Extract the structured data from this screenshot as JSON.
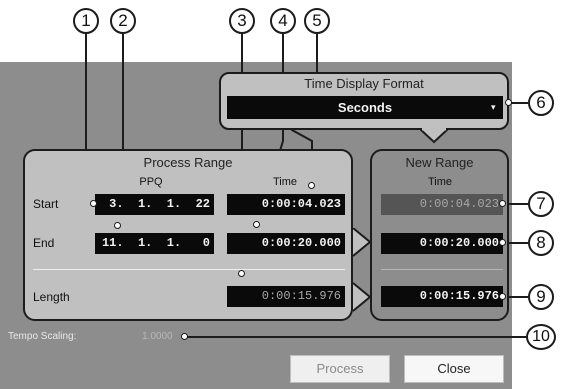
{
  "callouts": [
    "1",
    "2",
    "3",
    "4",
    "5",
    "6",
    "7",
    "8",
    "9",
    "10"
  ],
  "time_display_format": {
    "title": "Time Display Format",
    "selected": "Seconds"
  },
  "process_range": {
    "title": "Process Range",
    "col_ppq": "PPQ",
    "col_time": "Time",
    "rows": {
      "start_label": "Start",
      "start_ppq": "3.  1.  1.  22",
      "start_time": "0:00:04.023",
      "end_label": "End",
      "end_ppq": "11.  1.  1.   0",
      "end_time": "0:00:20.000",
      "length_label": "Length",
      "length_time": "0:00:15.976"
    }
  },
  "new_range": {
    "title": "New Range",
    "col_time": "Time",
    "start_time": "0:00:04.023",
    "end_time": "0:00:20.000",
    "length_time": "0:00:15.976"
  },
  "tempo_scaling": {
    "label": "Tempo Scaling:",
    "value": "1.0000"
  },
  "buttons": {
    "process": "Process",
    "close": "Close"
  }
}
